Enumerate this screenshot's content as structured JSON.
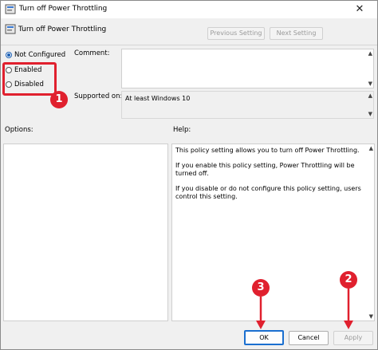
{
  "window": {
    "title": "Turn off Power Throttling",
    "close_glyph": "✕"
  },
  "header": {
    "policy_name": "Turn off Power Throttling",
    "previous_label": "Previous Setting",
    "next_label": "Next Setting"
  },
  "state": {
    "options": [
      {
        "label": "Not Configured",
        "checked": true
      },
      {
        "label": "Enabled",
        "checked": false
      },
      {
        "label": "Disabled",
        "checked": false
      }
    ]
  },
  "comment": {
    "label": "Comment:",
    "value": ""
  },
  "supported": {
    "label": "Supported on:",
    "value": "At least Windows 10"
  },
  "options_pane": {
    "label": "Options:"
  },
  "help_pane": {
    "label": "Help:",
    "paragraphs": [
      "This policy setting allows you to turn off Power Throttling.",
      "If you enable this policy setting, Power Throttling will be turned off.",
      "If you disable or do not configure this policy setting, users control this setting."
    ]
  },
  "footer": {
    "ok_label": "OK",
    "cancel_label": "Cancel",
    "apply_label": "Apply"
  },
  "annotations": {
    "badge_1": "1",
    "badge_2": "2",
    "badge_3": "3",
    "accent_color": "#e0202e"
  }
}
